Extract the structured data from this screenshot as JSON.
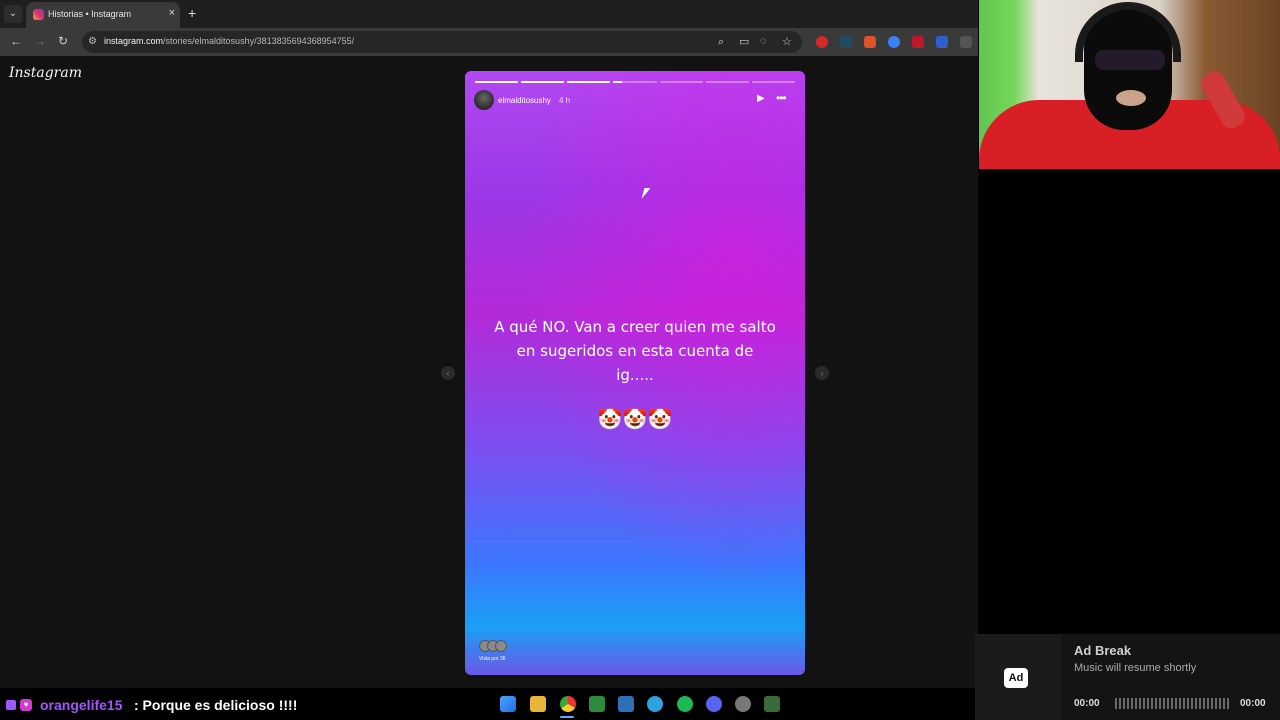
{
  "browser": {
    "tab_title": "Historias • Instagram",
    "tab_close": "×",
    "new_tab": "+",
    "url_domain": "instagram.com",
    "url_path": "/stories/elmalditosushy/3813835694368954755/"
  },
  "page": {
    "logo": "Instagram"
  },
  "story": {
    "username": "elmalditosushy",
    "time": "4 h",
    "text_line1": "A qué NO. Van a creer quien me salto",
    "text_line2": "en sugeridos en esta cuenta de",
    "text_line3": "ig.....",
    "emojis": "🤡🤡🤡",
    "viewers_label": "Vista por 36",
    "segments_total": 7,
    "segments_done": 3,
    "current_segment_progress": 0.2
  },
  "ad": {
    "badge": "Ad",
    "title": "Ad Break",
    "subtitle": "Music will resume shortly",
    "time_start": "00:00",
    "time_end": "00:00"
  },
  "chat": {
    "username": "orangelife15",
    "message": ": Porque es delicioso !!!!"
  },
  "colors": {
    "chat_username": "#a354ff",
    "story_top": "#b248f2",
    "story_bottom": "#1aa0f5"
  }
}
